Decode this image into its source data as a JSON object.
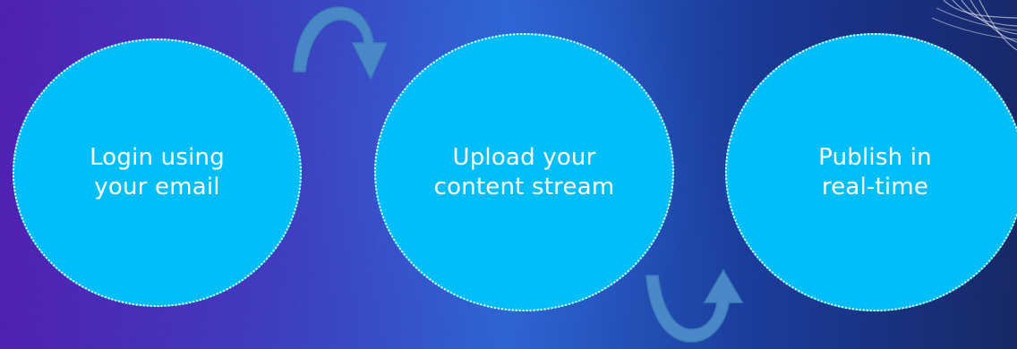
{
  "steps": [
    {
      "label": "Login using\nyour email"
    },
    {
      "label": "Upload your\ncontent stream"
    },
    {
      "label": "Publish in\nreal-time"
    }
  ],
  "colors": {
    "circle_fill": "#00bff8",
    "circle_border": "#ffffff",
    "arrow_fill": "#4a89c7"
  }
}
